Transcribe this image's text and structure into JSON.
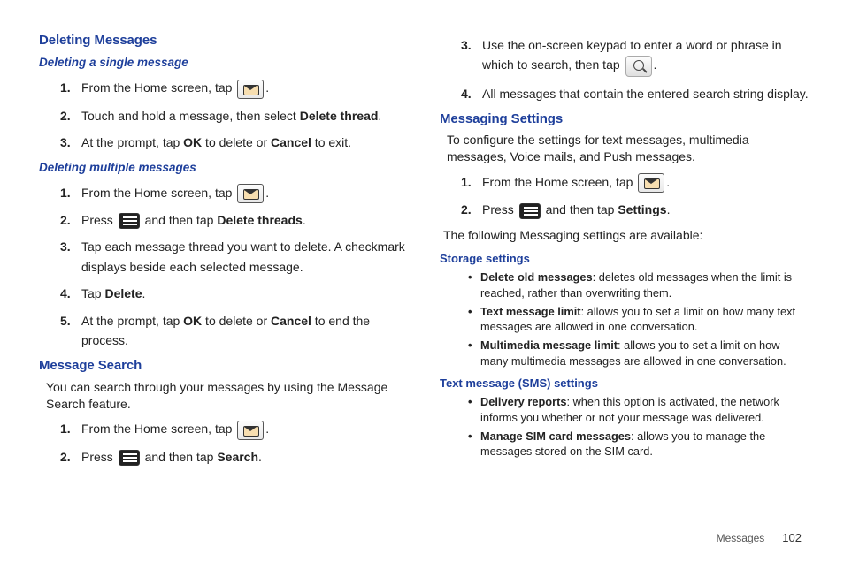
{
  "left": {
    "h_deleting": "Deleting Messages",
    "h_single": "Deleting a single message",
    "single": {
      "s1a": "From the Home screen, tap ",
      "s1b": ".",
      "s2a": "Touch and hold a message, then select ",
      "s2b": "Delete thread",
      "s2c": ".",
      "s3a": "At the prompt, tap ",
      "s3b": "OK",
      "s3c": " to delete or ",
      "s3d": "Cancel",
      "s3e": " to exit."
    },
    "h_multi": "Deleting multiple messages",
    "multi": {
      "m1a": "From the Home screen, tap ",
      "m1b": ".",
      "m2a": "Press ",
      "m2b": " and then tap ",
      "m2c": "Delete threads",
      "m2d": ".",
      "m3": "Tap each message thread you want to delete. A checkmark displays beside each selected message.",
      "m4a": "Tap ",
      "m4b": "Delete",
      "m4c": ".",
      "m5a": "At the prompt, tap ",
      "m5b": "OK",
      "m5c": " to delete or ",
      "m5d": "Cancel",
      "m5e": " to end the process."
    },
    "h_search": "Message Search",
    "search_intro": "You can search through your messages by using the Message Search feature.",
    "search": {
      "r1a": "From the Home screen, tap ",
      "r1b": ".",
      "r2a": "Press ",
      "r2b": " and then tap ",
      "r2c": "Search",
      "r2d": "."
    }
  },
  "right": {
    "cont": {
      "c3a": "Use the on-screen keypad to enter a word or phrase in which to search, then tap ",
      "c3b": ".",
      "c4": "All messages that contain the entered search string display."
    },
    "h_settings": "Messaging Settings",
    "settings_intro": "To configure the settings for text messages, multimedia messages, Voice mails, and Push messages.",
    "set": {
      "t1a": "From the Home screen, tap ",
      "t1b": ".",
      "t2a": "Press ",
      "t2b": " and then tap ",
      "t2c": "Settings",
      "t2d": "."
    },
    "following": "The following Messaging settings are available:",
    "h_storage": "Storage settings",
    "storage": {
      "b1a": "Delete old messages",
      "b1b": ": deletes old messages when the limit is reached, rather than overwriting them.",
      "b2a": "Text message limit",
      "b2b": ": allows you to set a limit on how many text messages are allowed in one conversation.",
      "b3a": "Multimedia message limit",
      "b3b": ": allows you to set a limit on how many multimedia messages are allowed in one conversation."
    },
    "h_sms": "Text message (SMS) settings",
    "sms": {
      "d1a": "Delivery reports",
      "d1b": ": when this option is activated, the network informs you whether or not your message was delivered.",
      "d2a": "Manage SIM card messages",
      "d2b": ": allows you to manage the messages stored on the SIM card."
    }
  },
  "footer": {
    "section": "Messages",
    "page": "102"
  },
  "nums": {
    "n1": "1.",
    "n2": "2.",
    "n3": "3.",
    "n4": "4.",
    "n5": "5."
  }
}
